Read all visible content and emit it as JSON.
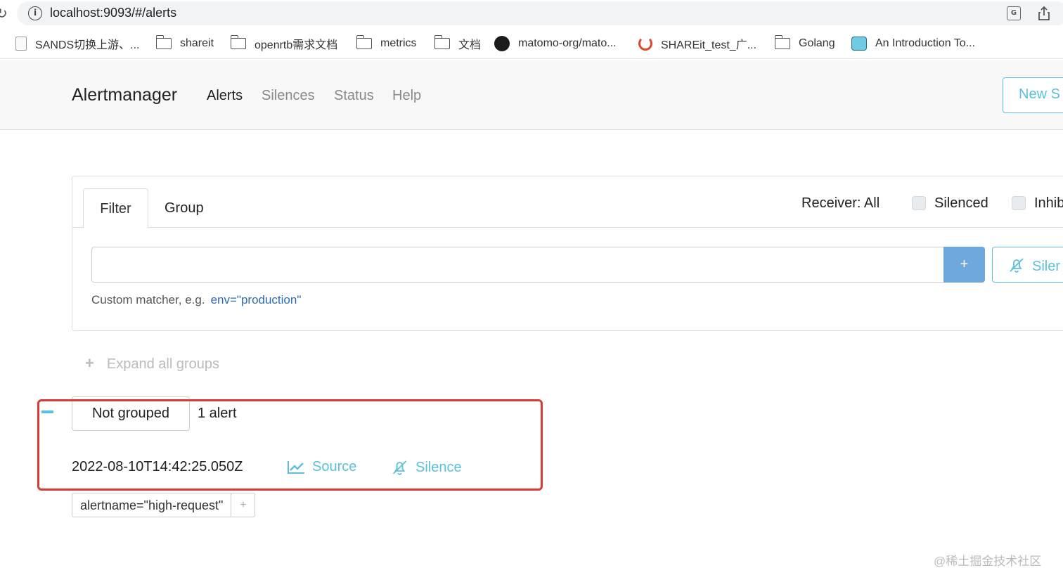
{
  "browser": {
    "url": "localhost:9093/#/alerts",
    "bookmarks": [
      {
        "label": "SANDS切换上游、...",
        "icon": "page-icon"
      },
      {
        "label": "shareit",
        "icon": "folder-icon"
      },
      {
        "label": "openrtb需求文档",
        "icon": "folder-icon"
      },
      {
        "label": "metrics",
        "icon": "folder-icon"
      },
      {
        "label": "文档",
        "icon": "folder-icon"
      },
      {
        "label": "matomo-org/mato...",
        "icon": "github-icon"
      },
      {
        "label": "SHAREit_test_广...",
        "icon": "ubuntu-icon"
      },
      {
        "label": "Golang",
        "icon": "folder-icon"
      },
      {
        "label": "An Introduction To...",
        "icon": "gopher-icon"
      }
    ]
  },
  "navbar": {
    "brand": "Alertmanager",
    "links": [
      "Alerts",
      "Silences",
      "Status",
      "Help"
    ],
    "active": "Alerts",
    "new_silence": "New S"
  },
  "filter": {
    "tabs": [
      "Filter",
      "Group"
    ],
    "receiver": "Receiver: All",
    "silenced_label": "Silenced",
    "inhibited_label": "Inhib",
    "input_value": "",
    "add_label": "+",
    "silence_label": "Siler",
    "hint": "Custom matcher, e.g.",
    "hint_example": "env=\"production\""
  },
  "groups": {
    "expand_label": "Expand all groups",
    "expand_symbol": "+",
    "group_name": "Not grouped",
    "count": "1 alert",
    "alert": {
      "timestamp": "2022-08-10T14:42:25.050Z",
      "source_label": "Source",
      "silence_label": "Silence",
      "label": "alertname=\"high-request\"",
      "label_add": "+"
    }
  },
  "colors": {
    "accent": "#5bc0de",
    "primary_button": "#6fa8dc",
    "highlight": "#d83a34"
  },
  "watermark": "@稀土掘金技术社区"
}
